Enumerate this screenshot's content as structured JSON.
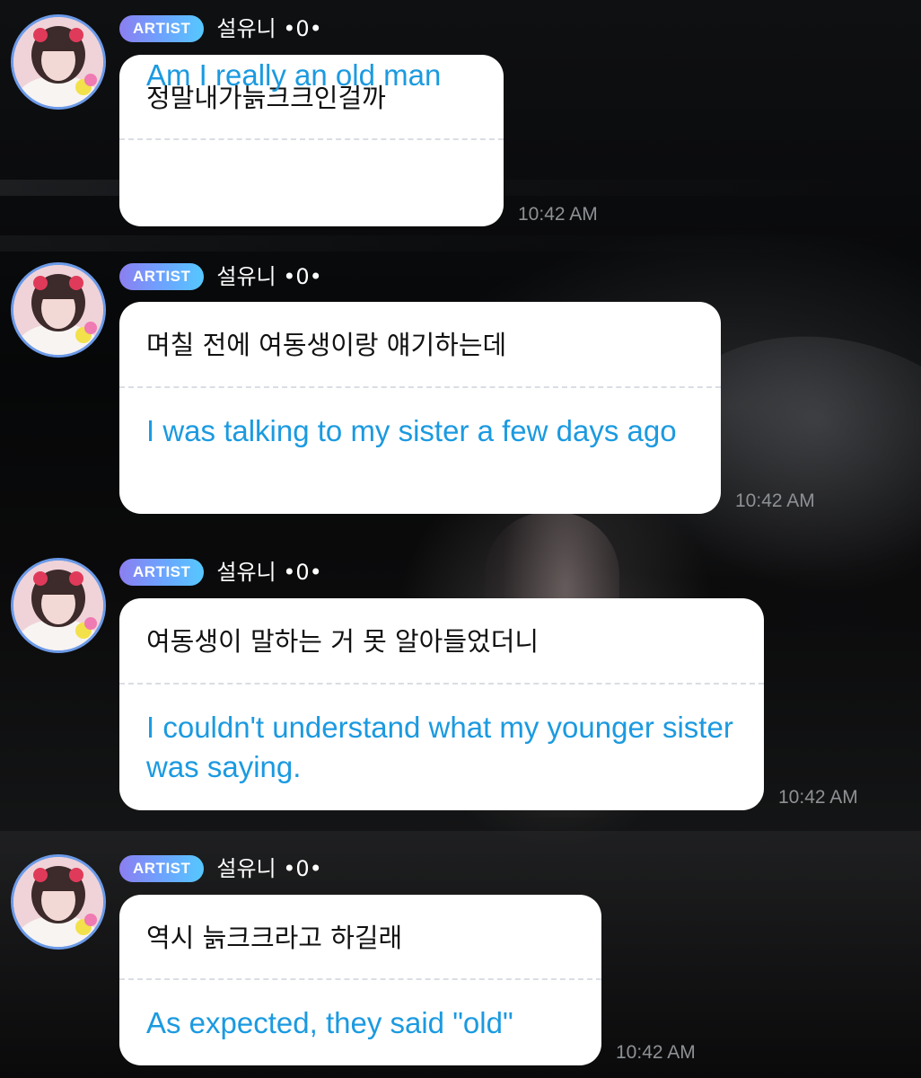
{
  "messages": [
    {
      "badge": "ARTIST",
      "nickname": "설유니 •0•",
      "original": "정말내가늙크크인걸까",
      "translation": "Am I really an old man",
      "time": "10:42 AM"
    },
    {
      "badge": "ARTIST",
      "nickname": "설유니 •0•",
      "original": "며칠 전에 여동생이랑 얘기하는데",
      "translation": "I was talking to my sister a few days ago",
      "time": "10:42 AM"
    },
    {
      "badge": "ARTIST",
      "nickname": "설유니 •0•",
      "original": "여동생이 말하는 거 못 알아들었더니",
      "translation": "I couldn't understand what my younger sister was saying.",
      "time": "10:42 AM"
    },
    {
      "badge": "ARTIST",
      "nickname": "설유니 •0•",
      "original": "역시 늙크크라고 하길래",
      "translation": "As expected, they said \"old\"",
      "time": "10:42 AM"
    }
  ],
  "icons": {
    "avatar": "profile-photo-avatar"
  },
  "colors": {
    "badge_gradient_start": "#8b7ff0",
    "badge_gradient_end": "#56c8ff",
    "translation_text": "#1b9ae0",
    "avatar_ring": "#6b9ae8",
    "timestamp": "#8e9194"
  }
}
